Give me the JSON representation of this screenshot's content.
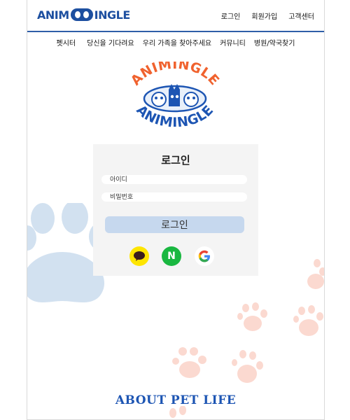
{
  "header": {
    "logo_left": "ANIM",
    "logo_right": "INGLE",
    "links": [
      "로그인",
      "회원가입",
      "고객센터"
    ]
  },
  "nav": {
    "items": [
      "펫시터",
      "당신을 기다려요",
      "우리 가족을 찾아주세요",
      "커뮤니티",
      "병원/약국찾기"
    ]
  },
  "brand": {
    "top_word": "ANIMINGLE",
    "bottom_word": "ANIMINGLE",
    "top_color": "#f0622e",
    "bottom_color": "#1d55b3"
  },
  "login": {
    "title": "로그인",
    "id_placeholder": "아이디",
    "pw_placeholder": "비밀번호",
    "submit_label": "로그인",
    "social": [
      {
        "icon": "kakao-icon",
        "color": "#fee500"
      },
      {
        "icon": "naver-icon",
        "label": "N",
        "color": "#19b740"
      },
      {
        "icon": "google-icon",
        "label": "G",
        "color": "#ffffff"
      }
    ]
  },
  "footer": {
    "title": "ABOUT PET LIFE"
  },
  "colors": {
    "accent_blue": "#2e5ea8",
    "paw_blue": "#d2e1f0",
    "paw_pink": "#fbd9d0"
  }
}
